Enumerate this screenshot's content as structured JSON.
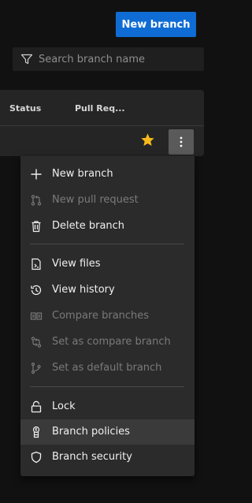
{
  "toolbar": {
    "new_branch_label": "New branch"
  },
  "search": {
    "placeholder": "Search branch name",
    "value": ""
  },
  "table": {
    "columns": [
      "Status",
      "Pull Req..."
    ]
  },
  "row": {
    "favorite": true,
    "more_icon": "more-vertical-icon",
    "star_color": "#f8b91c"
  },
  "menu": {
    "items": [
      {
        "label": "New branch",
        "icon": "plus-icon",
        "enabled": true
      },
      {
        "label": "New pull request",
        "icon": "pull-request-icon",
        "enabled": false
      },
      {
        "label": "Delete branch",
        "icon": "trash-icon",
        "enabled": true
      },
      {
        "label": "View files",
        "icon": "file-icon",
        "enabled": true
      },
      {
        "label": "View history",
        "icon": "history-icon",
        "enabled": true
      },
      {
        "label": "Compare branches",
        "icon": "compare-icon",
        "enabled": false
      },
      {
        "label": "Set as compare branch",
        "icon": "compare-branch-icon",
        "enabled": false
      },
      {
        "label": "Set as default branch",
        "icon": "default-branch-icon",
        "enabled": false
      },
      {
        "label": "Lock",
        "icon": "lock-icon",
        "enabled": true
      },
      {
        "label": "Branch policies",
        "icon": "policy-icon",
        "enabled": true,
        "hovered": true
      },
      {
        "label": "Branch security",
        "icon": "shield-icon",
        "enabled": true
      }
    ]
  },
  "colors": {
    "accent": "#0f6cd4",
    "background": "#111111",
    "panel": "#252525",
    "menu": "#2b2b2b"
  }
}
